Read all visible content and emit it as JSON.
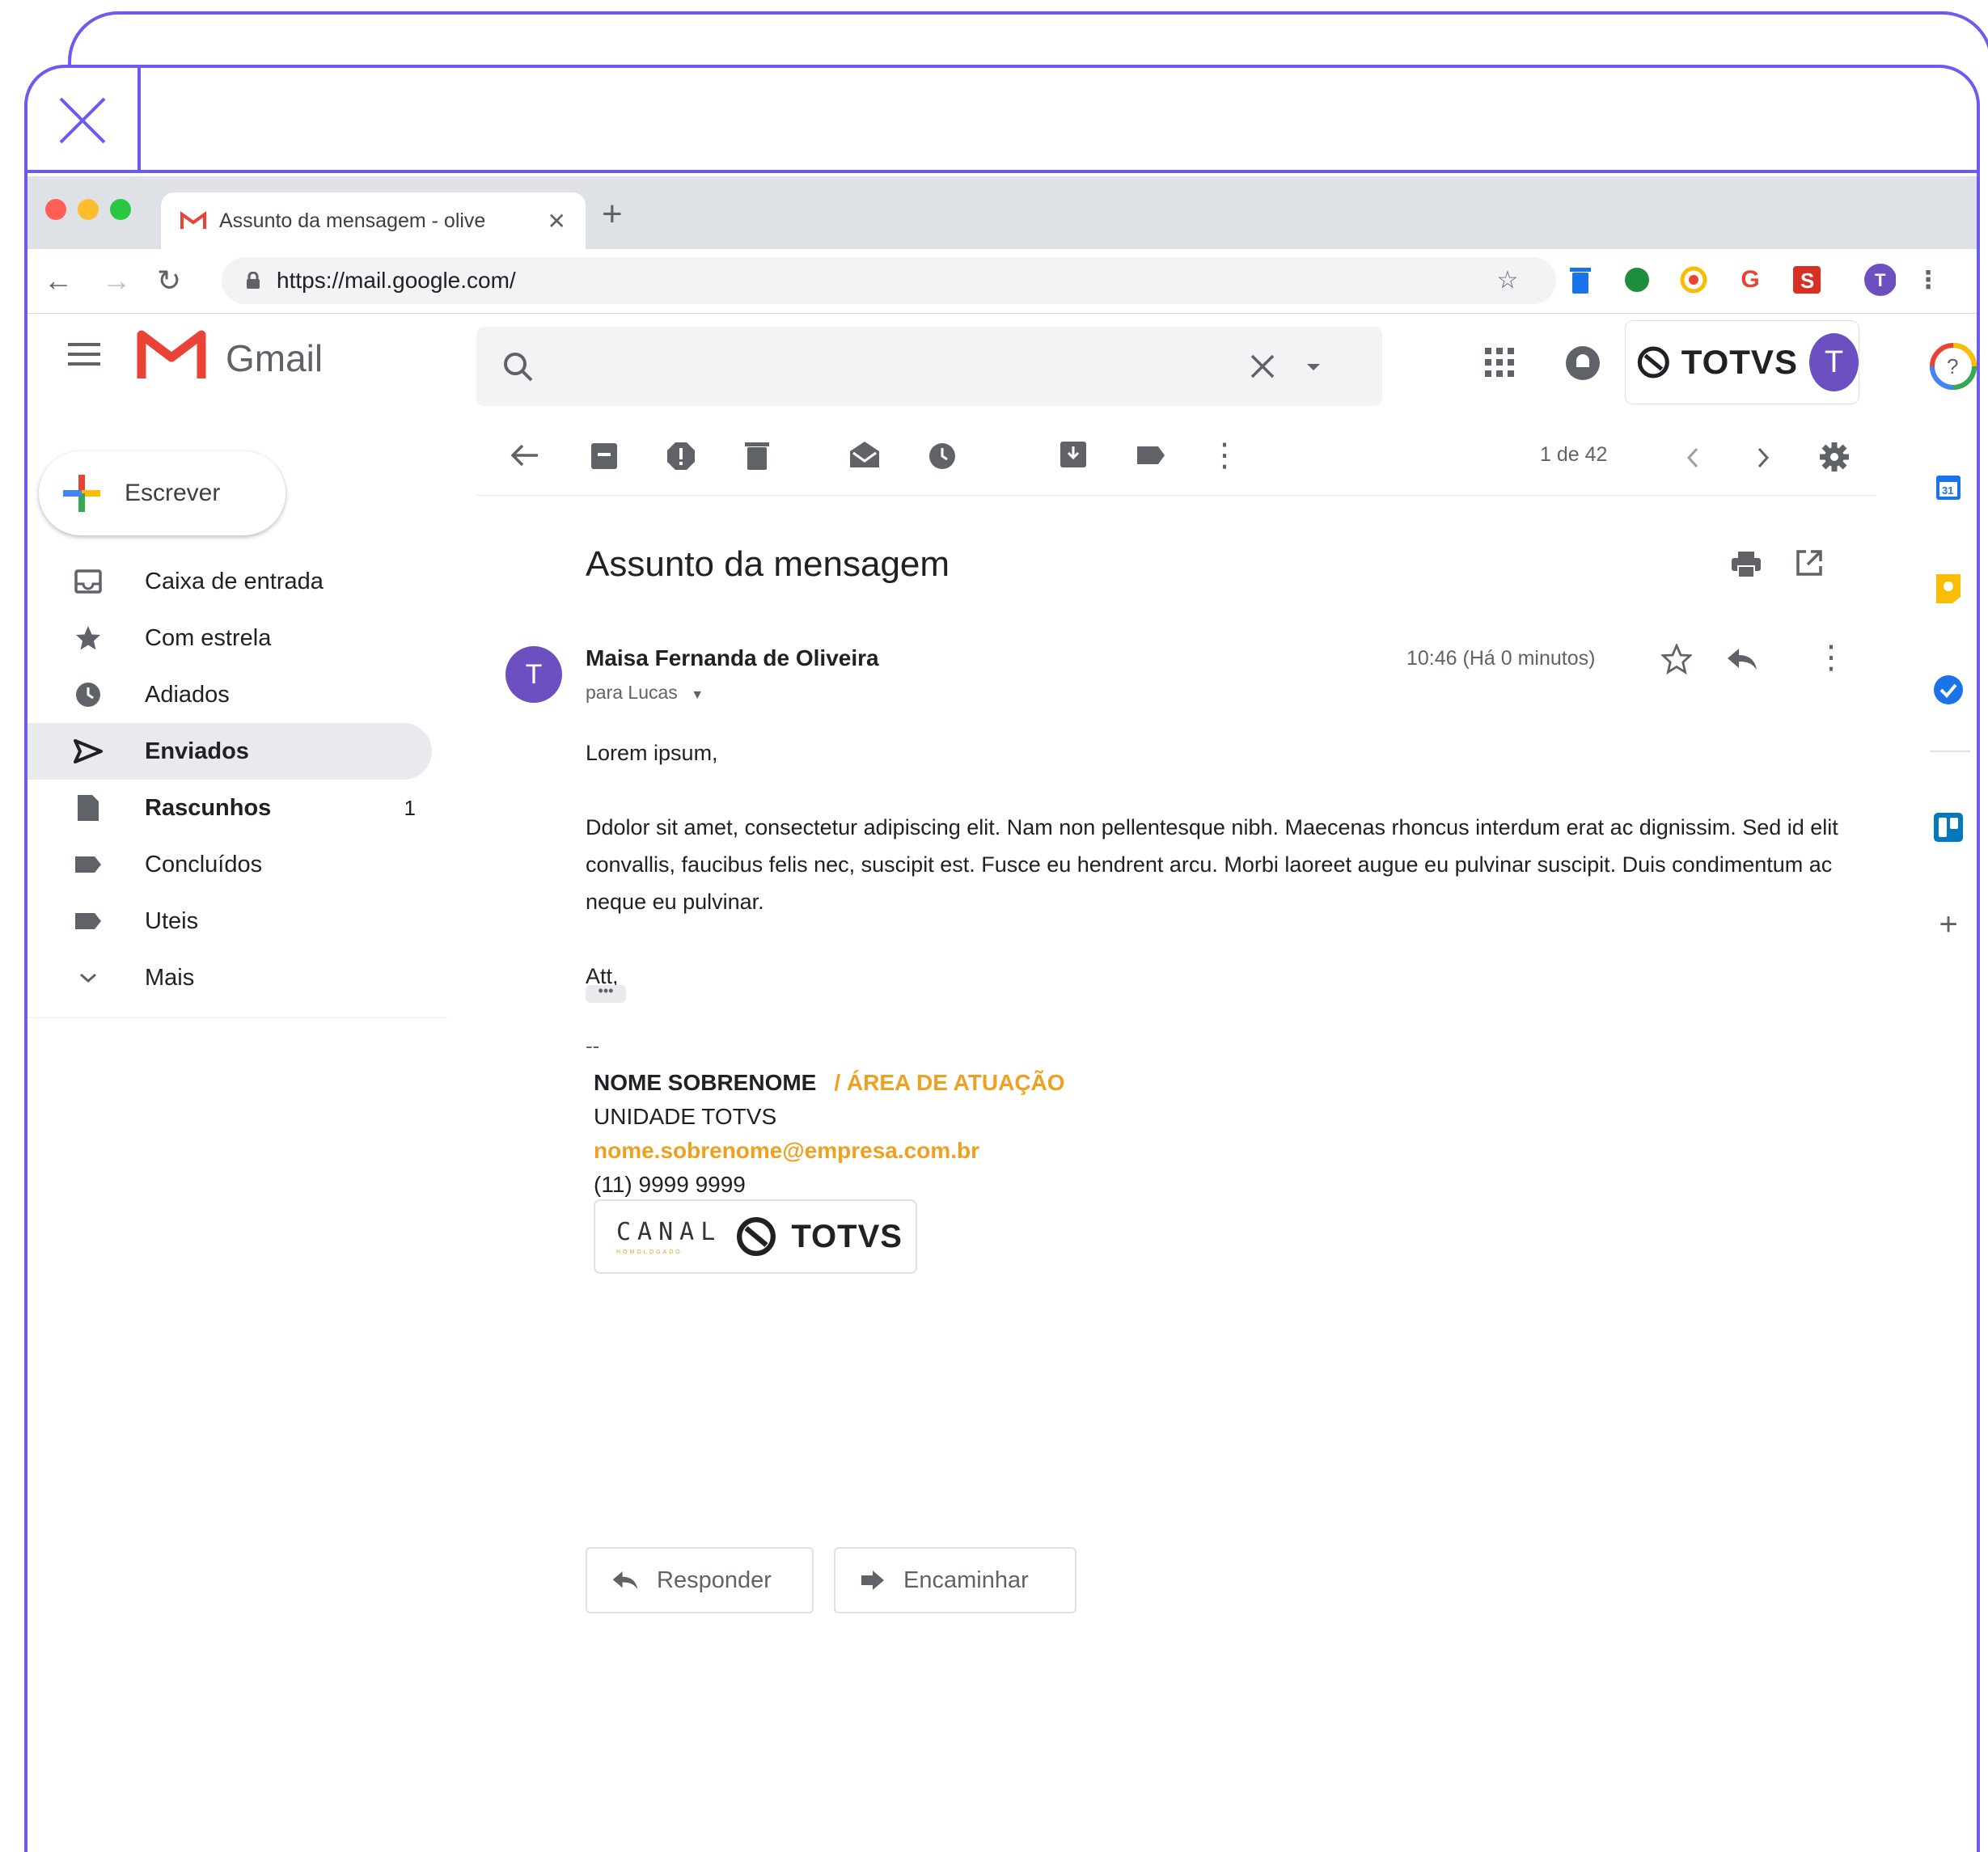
{
  "browser": {
    "tab_title": "Assunto da mensagem - olive",
    "url": "https://mail.google.com/"
  },
  "gmail": {
    "product_name": "Gmail",
    "brand": "TOTVS",
    "avatar_letter": "T"
  },
  "sidebar": {
    "compose_label": "Escrever",
    "items": [
      {
        "label": "Caixa de entrada",
        "icon": "inbox-icon",
        "count": ""
      },
      {
        "label": "Com estrela",
        "icon": "star-icon",
        "count": ""
      },
      {
        "label": "Adiados",
        "icon": "clock-icon",
        "count": ""
      },
      {
        "label": "Enviados",
        "icon": "send-icon",
        "count": ""
      },
      {
        "label": "Rascunhos",
        "icon": "draft-icon",
        "count": "1"
      },
      {
        "label": "Concluídos",
        "icon": "label-icon",
        "count": ""
      },
      {
        "label": "Uteis",
        "icon": "label-icon",
        "count": ""
      },
      {
        "label": "Mais",
        "icon": "chevron-down-icon",
        "count": ""
      }
    ]
  },
  "toolbar": {
    "pager": "1 de 42"
  },
  "message": {
    "subject": "Assunto da mensagem",
    "sender": "Maisa Fernanda de Oliveira",
    "avatar_letter": "T",
    "recipient": "para Lucas",
    "timestamp": "10:46 (Há 0 minutos)",
    "greeting": "Lorem ipsum,",
    "paragraph": "Ddolor sit amet, consectetur adipiscing elit. Nam non pellentesque nibh. Maecenas rhoncus interdum erat ac dignissim. Sed id elit convallis, faucibus felis nec, suscipit est. Fusce eu hendrent arcu. Morbi laoreet augue eu pulvinar suscipit. Duis condimentum ac neque eu pulvinar.",
    "closing": "Att,",
    "ellipsis": "•••",
    "sig_separator": "--"
  },
  "signature": {
    "name": "NOME SOBRENOME",
    "area": "/ ÁREA DE ATUAÇÃO",
    "unit": "UNIDADE TOTVS",
    "email": "nome.sobrenome@empresa.com.br",
    "phone": "(11) 9999 9999",
    "logo_canal": "CANAL",
    "logo_canal_sub": "HOMOLOGADO",
    "logo_brand": "TOTVS"
  },
  "actions": {
    "reply": "Responder",
    "forward": "Encaminhar"
  },
  "colors": {
    "frame": "#6b5bf0",
    "accent_orange": "#f0a020",
    "avatar": "#6c4fc1"
  }
}
